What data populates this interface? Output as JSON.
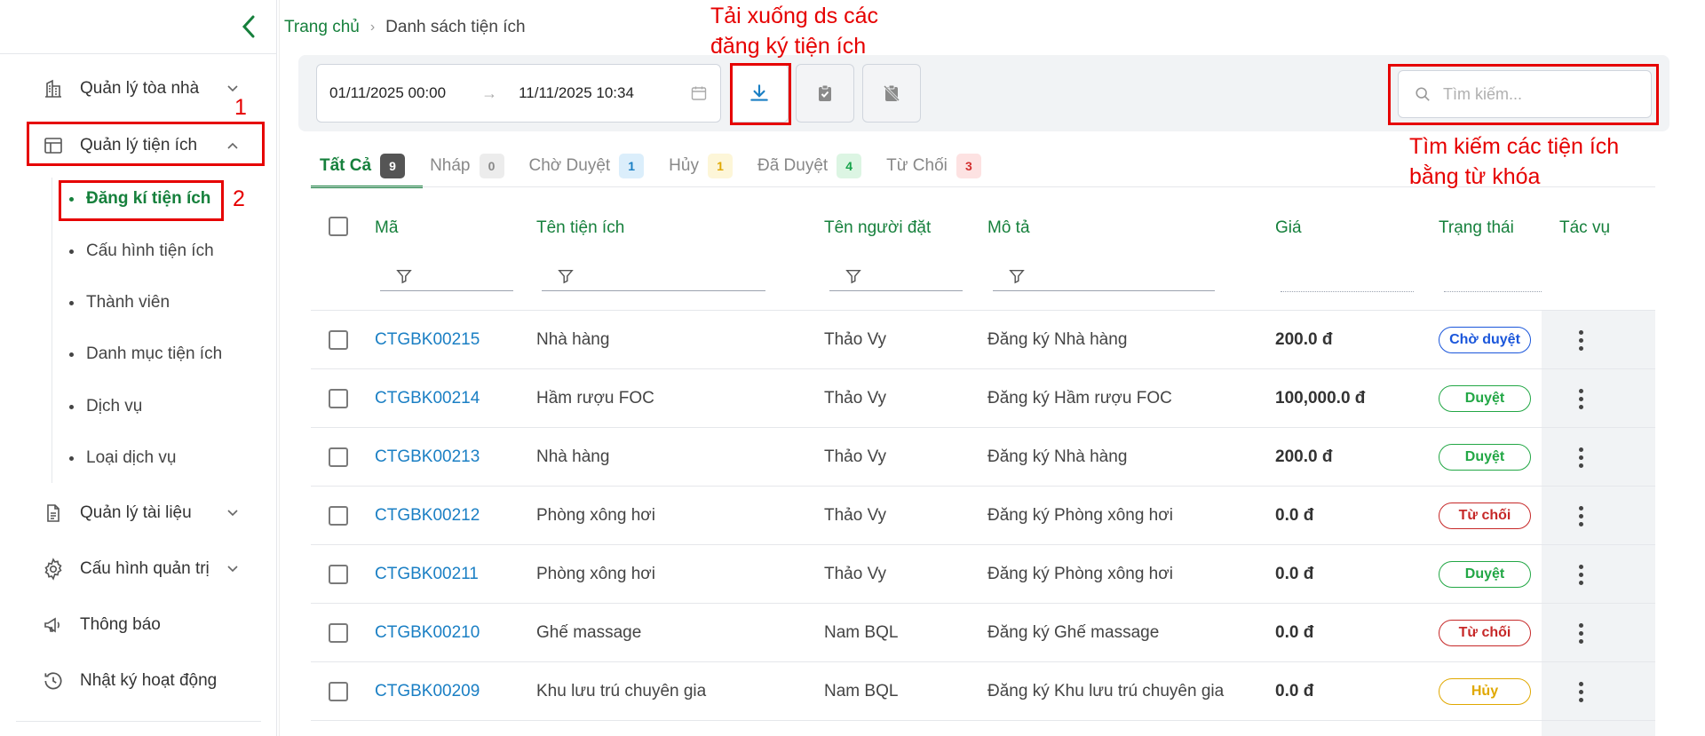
{
  "sidebar": {
    "items": [
      {
        "label": "Quản lý tòa nhà",
        "icon": "building-icon"
      },
      {
        "label": "Quản lý tiện ích",
        "icon": "layout-icon"
      },
      {
        "label": "Quản lý tài liệu",
        "icon": "document-icon"
      },
      {
        "label": "Cấu hình quản trị",
        "icon": "gear-icon"
      },
      {
        "label": "Thông báo",
        "icon": "megaphone-icon"
      },
      {
        "label": "Nhật ký hoạt động",
        "icon": "history-icon"
      }
    ],
    "sub_items": [
      {
        "label": "Đăng kí tiện ích"
      },
      {
        "label": "Cấu hình tiện ích"
      },
      {
        "label": "Thành viên"
      },
      {
        "label": "Danh mục tiện ích"
      },
      {
        "label": "Dịch vụ"
      },
      {
        "label": "Loại dịch vụ"
      }
    ]
  },
  "annotations": {
    "step1": "1",
    "step2": "2",
    "download_note_line1": "Tải xuống ds các",
    "download_note_line2": "đăng ký tiện ích",
    "search_note_line1": "Tìm kiếm các tiện ích",
    "search_note_line2": "bằng từ khóa"
  },
  "breadcrumb": {
    "home": "Trang chủ",
    "current": "Danh sách tiện ích"
  },
  "toolbar": {
    "date_from": "01/11/2025 00:00",
    "date_arrow": "→",
    "date_to": "11/11/2025 10:34",
    "search_placeholder": "Tìm kiếm..."
  },
  "tabs": [
    {
      "label": "Tất Cả",
      "count": "9",
      "badge_bg": "#555555",
      "badge_fg": "#ffffff"
    },
    {
      "label": "Nháp",
      "count": "0",
      "badge_bg": "#ececec",
      "badge_fg": "#888888"
    },
    {
      "label": "Chờ Duyệt",
      "count": "1",
      "badge_bg": "#dbeefb",
      "badge_fg": "#1a7fc4"
    },
    {
      "label": "Hủy",
      "count": "1",
      "badge_bg": "#fdf6d8",
      "badge_fg": "#e0a800"
    },
    {
      "label": "Đã Duyệt",
      "count": "4",
      "badge_bg": "#dcf5e3",
      "badge_fg": "#16a34a"
    },
    {
      "label": "Từ Chối",
      "count": "3",
      "badge_bg": "#fde2e2",
      "badge_fg": "#d32f2f"
    }
  ],
  "table": {
    "headers": {
      "code": "Mã",
      "name": "Tên tiện ích",
      "booker": "Tên người đặt",
      "description": "Mô tả",
      "price": "Giá",
      "status": "Trạng thái",
      "actions": "Tác vụ"
    },
    "rows": [
      {
        "code": "CTGBK00215",
        "name": "Nhà hàng",
        "booker": "Thảo Vy",
        "description": "Đăng ký Nhà hàng",
        "price": "200.0 đ",
        "status": "Chờ duyệt",
        "status_color": "#1a56db"
      },
      {
        "code": "CTGBK00214",
        "name": "Hầm rượu FOC",
        "booker": "Thảo Vy",
        "description": "Đăng ký Hầm rượu FOC",
        "price": "100,000.0 đ",
        "status": "Duyệt",
        "status_color": "#22a745"
      },
      {
        "code": "CTGBK00213",
        "name": "Nhà hàng",
        "booker": "Thảo Vy",
        "description": "Đăng ký Nhà hàng",
        "price": "200.0 đ",
        "status": "Duyệt",
        "status_color": "#22a745"
      },
      {
        "code": "CTGBK00212",
        "name": "Phòng xông hơi",
        "booker": "Thảo Vy",
        "description": "Đăng ký Phòng xông hơi",
        "price": "0.0 đ",
        "status": "Từ chối",
        "status_color": "#c62828"
      },
      {
        "code": "CTGBK00211",
        "name": "Phòng xông hơi",
        "booker": "Thảo Vy",
        "description": "Đăng ký Phòng xông hơi",
        "price": "0.0 đ",
        "status": "Duyệt",
        "status_color": "#22a745"
      },
      {
        "code": "CTGBK00210",
        "name": "Ghế massage",
        "booker": "Nam BQL",
        "description": "Đăng ký Ghế massage",
        "price": "0.0 đ",
        "status": "Từ chối",
        "status_color": "#c62828"
      },
      {
        "code": "CTGBK00209",
        "name": "Khu lưu trú chuyên gia",
        "booker": "Nam BQL",
        "description": "Đăng ký Khu lưu trú chuyên gia",
        "price": "0.0 đ",
        "status": "Hủy",
        "status_color": "#e0a800"
      }
    ]
  }
}
